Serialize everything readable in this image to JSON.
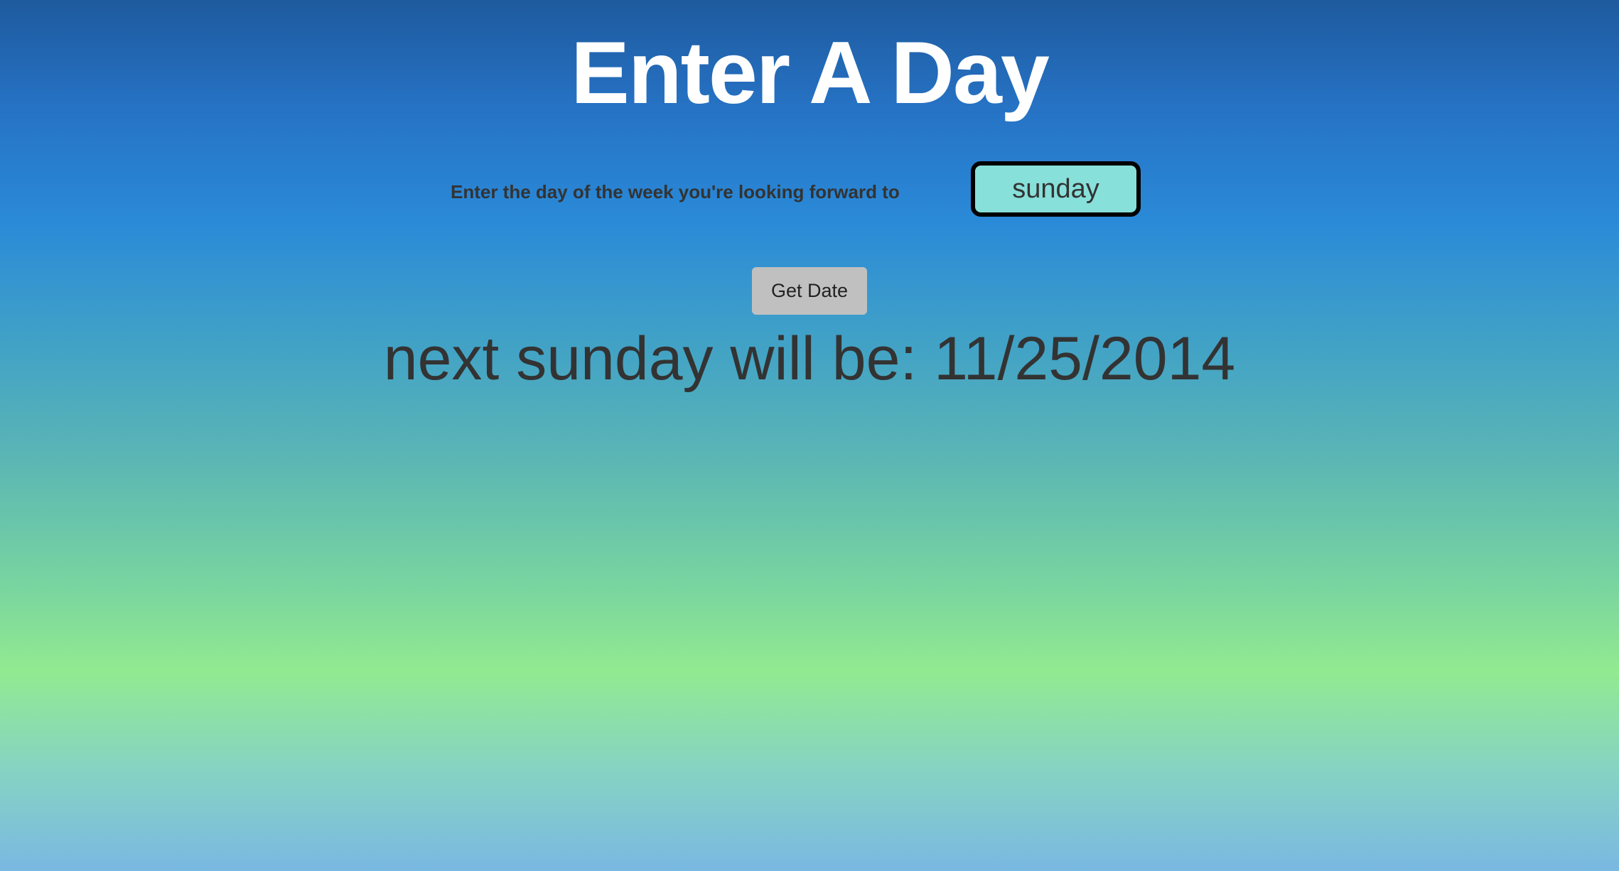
{
  "title": "Enter A Day",
  "form": {
    "label": "Enter the day of the week you're looking forward to",
    "day_input_value": "sunday",
    "submit_label": "Get Date"
  },
  "result": "next sunday will be: 11/25/2014"
}
